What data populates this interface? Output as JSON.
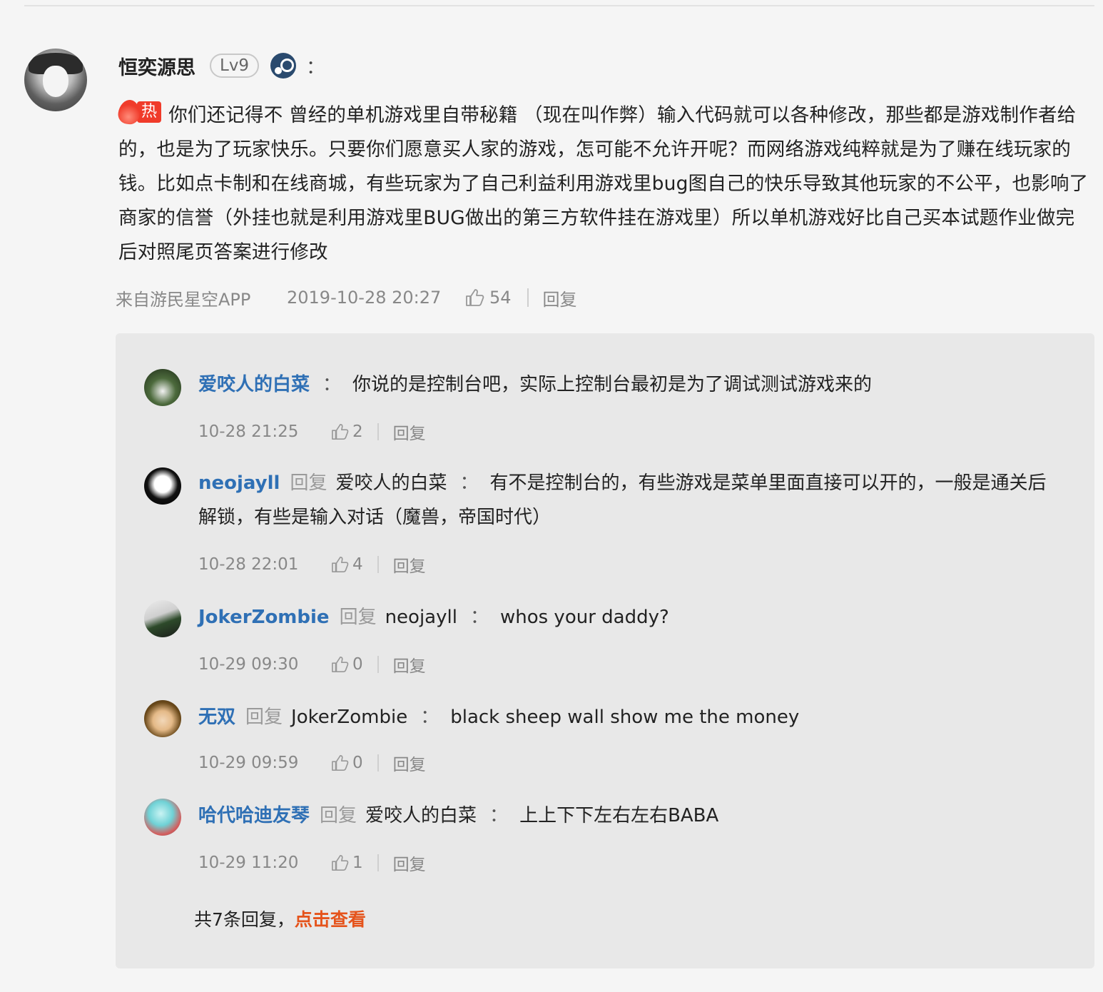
{
  "main_comment": {
    "author": "恒奕源思",
    "level": "Lv9",
    "colon": "：",
    "hot_label": "热",
    "text": "你们还记得不 曾经的单机游戏里自带秘籍 （现在叫作弊）输入代码就可以各种修改，那些都是游戏制作者给的，也是为了玩家快乐。只要你们愿意买人家的游戏，怎可能不允许开呢？而网络游戏纯粹就是为了赚在线玩家的钱。比如点卡制和在线商城，有些玩家为了自己利益利用游戏里bug图自己的快乐导致其他玩家的不公平，也影响了商家的信誉（外挂也就是利用游戏里BUG做出的第三方软件挂在游戏里）所以单机游戏好比自己买本试题作业做完后对照尾页答案进行修改",
    "source": "来自游民星空APP",
    "time": "2019-10-28 20:27",
    "likes": "54",
    "reply_label": "回复"
  },
  "replies": [
    {
      "user": "爱咬人的白菜",
      "reply_word": "",
      "target": "",
      "colon": "：",
      "text": "你说的是控制台吧，实际上控制台最初是为了调试测试游戏来的",
      "time": "10-28 21:25",
      "likes": "2",
      "reply_label": "回复"
    },
    {
      "user": "neojayll",
      "reply_word": "回复",
      "target": "爱咬人的白菜",
      "colon": "：",
      "text": "有不是控制台的，有些游戏是菜单里面直接可以开的，一般是通关后解锁，有些是输入对话（魔兽，帝国时代）",
      "time": "10-28 22:01",
      "likes": "4",
      "reply_label": "回复"
    },
    {
      "user": "JokerZombie",
      "reply_word": "回复",
      "target": "neojayll",
      "colon": "：",
      "text": "whos your daddy?",
      "time": "10-29 09:30",
      "likes": "0",
      "reply_label": "回复"
    },
    {
      "user": "无双",
      "reply_word": "回复",
      "target": "JokerZombie",
      "colon": "：",
      "text": "black sheep wall show me the money",
      "time": "10-29 09:59",
      "likes": "0",
      "reply_label": "回复"
    },
    {
      "user": "哈代哈迪友琴",
      "reply_word": "回复",
      "target": "爱咬人的白菜",
      "colon": "：",
      "text": "上上下下左右左右BABA",
      "time": "10-29 11:20",
      "likes": "1",
      "reply_label": "回复"
    }
  ],
  "footer": {
    "summary": "共7条回复，",
    "link": "点击查看"
  },
  "colors": {
    "username": "#2f70b5",
    "hot": "#f03b2a",
    "link": "#e5531b"
  }
}
